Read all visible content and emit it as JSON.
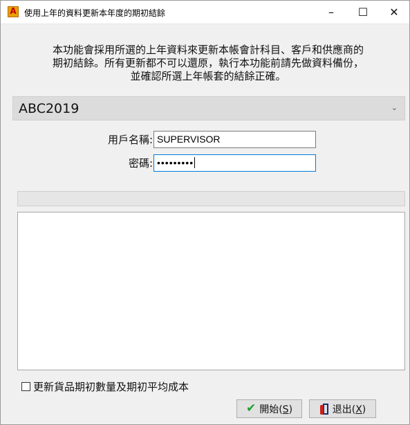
{
  "window": {
    "title": "使用上年的資料更新本年度的期初結餘",
    "icon": "app-icon",
    "controls": {
      "minimize": "–",
      "maximize": "☐",
      "close": "✕"
    }
  },
  "intro_lines": [
    "本功能會採用所選的上年資料來更新本帳會計科目、客戶和供應商的",
    "期初結餘。所有更新都不可以還原，執行本功能前請先做資料備份，",
    "並確認所選上年帳套的結餘正確。"
  ],
  "company_select": {
    "value": "ABC2019",
    "chevron": "chevron-down-icon"
  },
  "form": {
    "username_label": "用戶名稱:",
    "username_value": "SUPERVISOR",
    "password_label": "密碼:",
    "password_value": "•••••••••"
  },
  "progress": {
    "value": 0
  },
  "log": {
    "lines": []
  },
  "option": {
    "label": "更新貨品期初數量及期初平均成本",
    "checked": false
  },
  "buttons": {
    "start": {
      "label": "開始(",
      "key": "S",
      "suffix": ")"
    },
    "exit": {
      "label": "退出(",
      "key": "X",
      "suffix": ")"
    }
  },
  "colors": {
    "title_bg": "#ffffff",
    "focus_border": "#0078d7",
    "check_icon": "#1f9d2b"
  }
}
